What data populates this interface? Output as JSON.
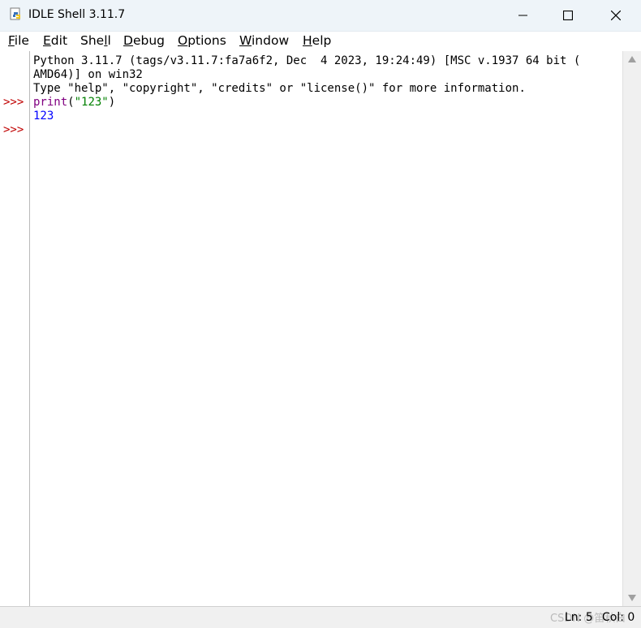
{
  "window": {
    "title": "IDLE Shell 3.11.7",
    "minimize_icon": "minimize-icon",
    "maximize_icon": "maximize-icon",
    "close_icon": "close-icon"
  },
  "menu": [
    {
      "label": "File",
      "ul": "F",
      "rest": "ile"
    },
    {
      "label": "Edit",
      "ul": "E",
      "rest": "dit"
    },
    {
      "label": "Shell",
      "pre": "She",
      "ul": "l",
      "rest": "l"
    },
    {
      "label": "Debug",
      "ul": "D",
      "rest": "ebug"
    },
    {
      "label": "Options",
      "ul": "O",
      "rest": "ptions"
    },
    {
      "label": "Window",
      "ul": "W",
      "rest": "indow"
    },
    {
      "label": "Help",
      "ul": "H",
      "rest": "elp"
    }
  ],
  "gutter": {
    "prompt1": ">>>",
    "prompt2": ">>>"
  },
  "shell": {
    "banner1": "Python 3.11.7 (tags/v3.11.7:fa7a6f2, Dec  4 2023, 19:24:49) [MSC v.1937 64 bit (",
    "banner2": "AMD64)] on win32",
    "banner3": "Type \"help\", \"copyright\", \"credits\" or \"license()\" for more information.",
    "input_func": "print",
    "input_open": "(",
    "input_str": "\"123\"",
    "input_close": ")",
    "output": "123"
  },
  "status": {
    "ln": "Ln: 5",
    "col": "Col: 0",
    "watermark": "CSDN @笛秋白"
  },
  "colors": {
    "keyword": "#800080",
    "string": "#008000",
    "output": "#0000ff",
    "prompt": "#c00000"
  }
}
